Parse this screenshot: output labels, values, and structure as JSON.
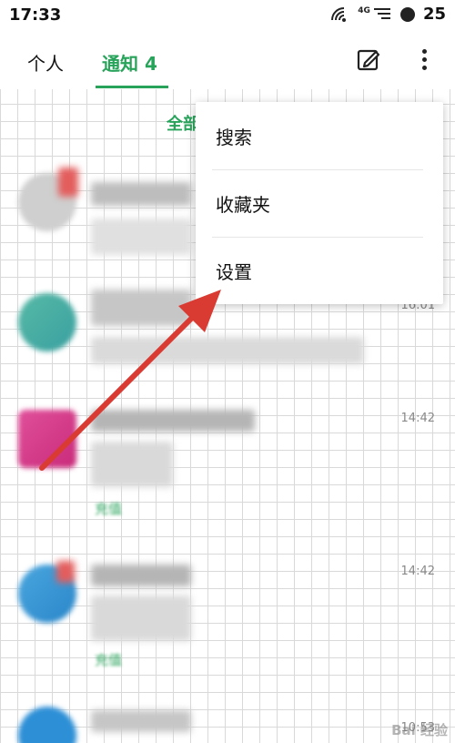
{
  "status_bar": {
    "time": "17:33",
    "network": "4G",
    "battery": "25"
  },
  "header": {
    "tab_personal": "个人",
    "tab_notify": "通知 4"
  },
  "list": {
    "filter_label": "全部",
    "rows": [
      {
        "time": ""
      },
      {
        "time": "16:01"
      },
      {
        "time": "14:42",
        "tag": "充值"
      },
      {
        "time": "14:42",
        "tag": "充值"
      },
      {
        "time": "10:53"
      }
    ]
  },
  "menu": {
    "items": [
      {
        "label": "搜索"
      },
      {
        "label": "收藏夹"
      },
      {
        "label": "设置"
      }
    ]
  },
  "watermark": "Bai 经验",
  "colors": {
    "accent": "#27a35a",
    "arrow": "#d93a32"
  }
}
